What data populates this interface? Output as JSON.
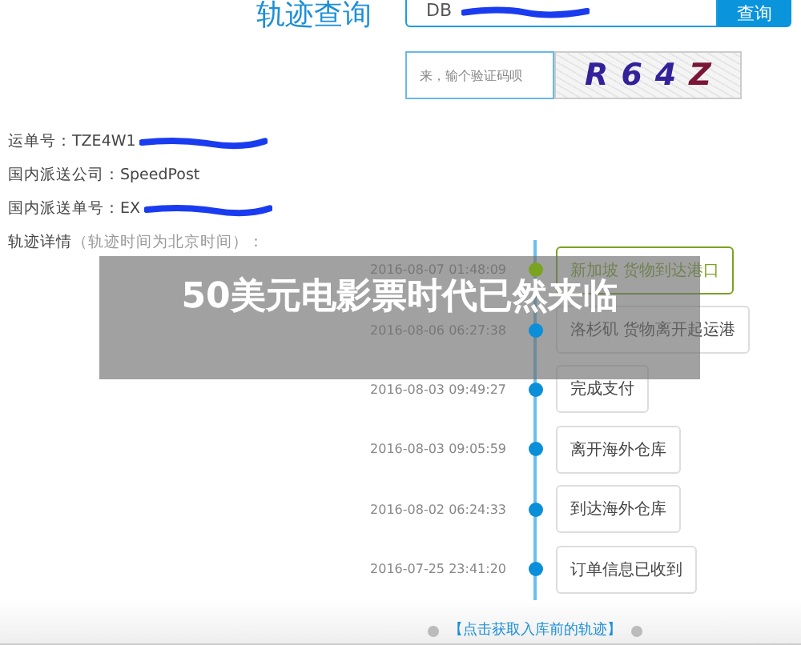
{
  "header": {
    "title": "轨迹查询",
    "search_value": "DB",
    "search_button": "查询"
  },
  "captcha": {
    "placeholder": "来，输个验证码呗",
    "code": [
      "R",
      "6",
      "4",
      "Z"
    ]
  },
  "info": [
    {
      "label": "运单号：",
      "value": "TZE4W1"
    },
    {
      "label": "国内派送公司：",
      "value": "SpeedPost"
    },
    {
      "label": "国内派送单号：",
      "value": "EX"
    }
  ],
  "details": {
    "label": "轨迹详情",
    "note": "（轨迹时间为北京时间）："
  },
  "events": [
    {
      "time": "2016-08-07 01:48:09",
      "text": "新加坡 货物到达港口",
      "color": "#7aa320"
    },
    {
      "time": "2016-08-06 06:27:38",
      "text": "洛杉矶 货物离开起运港",
      "color": "#0a8fd8"
    },
    {
      "time": "2016-08-03 09:49:27",
      "text": "完成支付",
      "color": "#0a8fd8"
    },
    {
      "time": "2016-08-03 09:05:59",
      "text": "离开海外仓库",
      "color": "#0a8fd8"
    },
    {
      "time": "2016-08-02 06:24:33",
      "text": "到达海外仓库",
      "color": "#0a8fd8"
    },
    {
      "time": "2016-07-25 23:41:20",
      "text": "订单信息已收到",
      "color": "#0a8fd8"
    }
  ],
  "more_link": "【点击获取入库前的轨迹】",
  "banner": "50美元电影票时代已然来临"
}
